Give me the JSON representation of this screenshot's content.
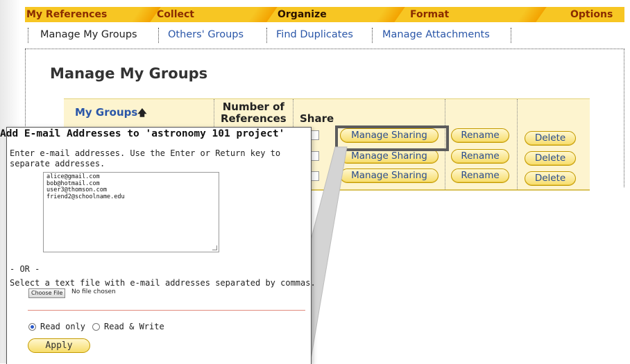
{
  "topnav": {
    "tabs": [
      "My References",
      "Collect",
      "Organize",
      "Format",
      "Options"
    ],
    "active": "Organize"
  },
  "subnav": {
    "items": [
      "Manage My Groups",
      "Others' Groups",
      "Find Duplicates",
      "Manage Attachments"
    ]
  },
  "page": {
    "title": "Manage My Groups"
  },
  "groups_table": {
    "col_groups": "My Groups",
    "sort_icon": "sort-up-arrow",
    "col_refs_1": "Number of",
    "col_refs_2": "References",
    "col_share": "Share",
    "manage_sharing_label": "Manage Sharing",
    "rename_label": "Rename",
    "delete_label": "Delete"
  },
  "popup": {
    "title": "Add E-mail Addresses to 'astronomy 101 project'",
    "instructions_1": "Enter e-mail addresses. Use the Enter or Return key to",
    "instructions_2": "separate addresses.",
    "emails": [
      "alice@gmail.com",
      "bob@hotmail.com",
      "user3@thomson.com",
      "friend2@schoolname.edu"
    ],
    "or_label": "- OR -",
    "file_instructions": "Select a text file with e-mail addresses separated by commas.",
    "choose_file_label": "Choose File",
    "no_file_label": "No file chosen",
    "read_only_label": "Read only",
    "read_write_label": "Read & Write",
    "permission_selected": "Read only",
    "apply_label": "Apply"
  },
  "colors": {
    "nav_yellow": "#f7c623",
    "nav_text": "#8a2c00",
    "link_blue": "#2a56a8",
    "table_bg": "#fdf4cf"
  }
}
